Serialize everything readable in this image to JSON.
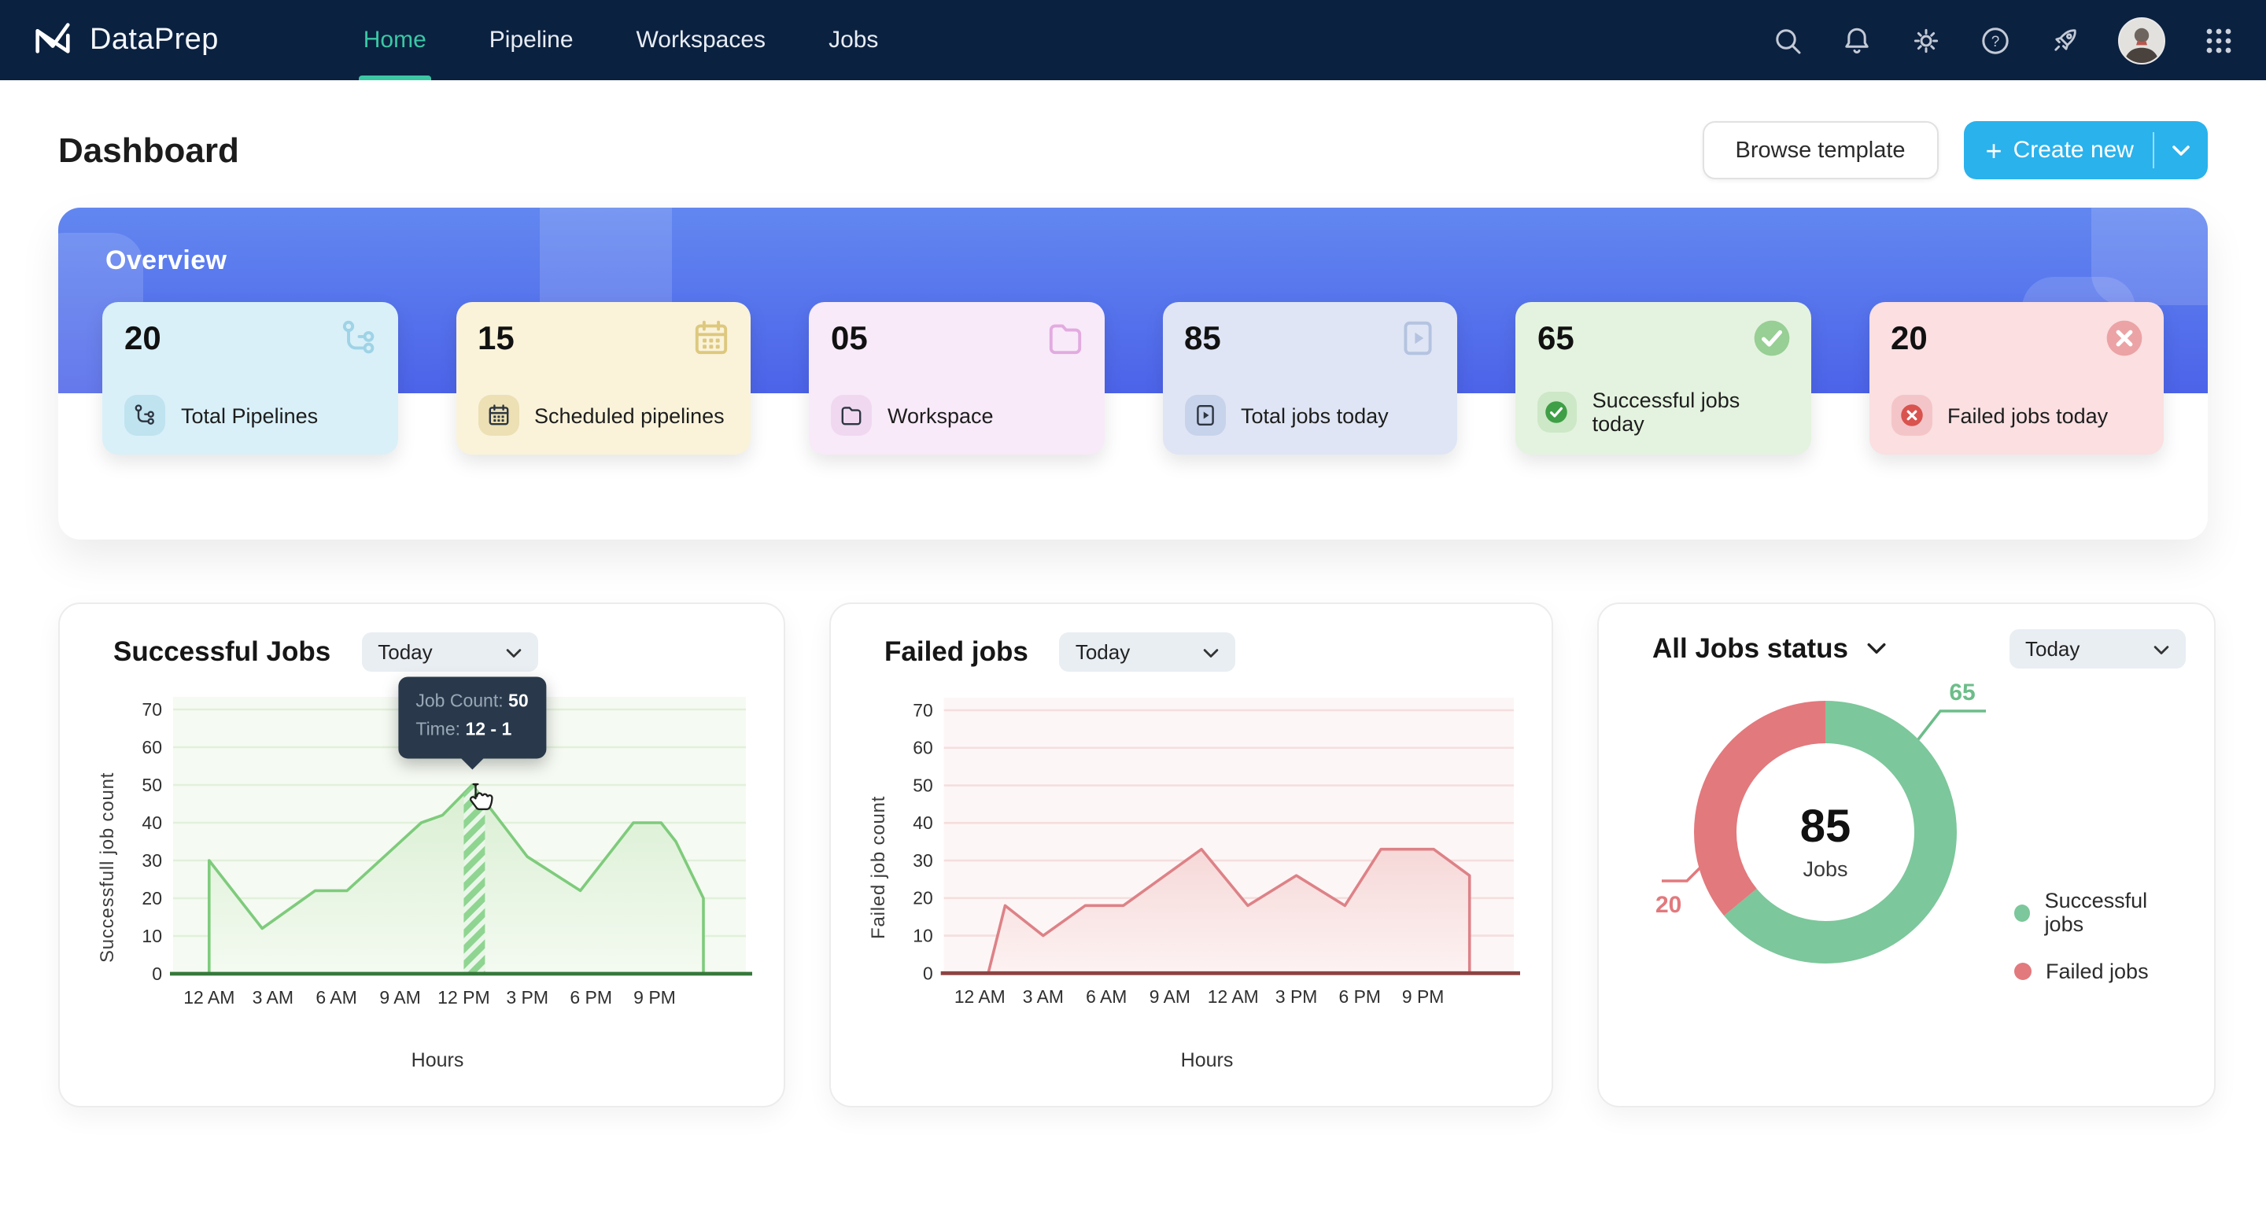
{
  "nav": {
    "brand": "DataPrep",
    "items": [
      {
        "label": "Home",
        "active": true
      },
      {
        "label": "Pipeline",
        "active": false
      },
      {
        "label": "Workspaces",
        "active": false
      },
      {
        "label": "Jobs",
        "active": false
      }
    ],
    "right_icons": [
      "search-icon",
      "bell-icon",
      "gear-icon",
      "help-icon",
      "rocket-icon",
      "avatar",
      "apps-grid-icon"
    ]
  },
  "header": {
    "title": "Dashboard",
    "browse_label": "Browse template",
    "create_label": "Create new"
  },
  "overview": {
    "title": "Overview",
    "cards": [
      {
        "value": "20",
        "label": "Total Pipelines",
        "icon": "pipeline-icon",
        "bg": "#d9f0f9",
        "chip": "#bfe3ef",
        "ghost": "#9fd3e6",
        "glyph": "#23454f"
      },
      {
        "value": "15",
        "label": "Scheduled pipelines",
        "icon": "calendar-icon",
        "bg": "#faf3da",
        "chip": "#ece0b4",
        "ghost": "#ddc87e",
        "glyph": "#4a4018"
      },
      {
        "value": "05",
        "label": "Workspace",
        "icon": "folder-icon",
        "bg": "#f8eaf9",
        "chip": "#f0d8f1",
        "ghost": "#e2abe0",
        "glyph": "#3f2a40"
      },
      {
        "value": "85",
        "label": "Total jobs today",
        "icon": "play-doc-icon",
        "bg": "#dfe5f4",
        "chip": "#c7d2eb",
        "ghost": "#b4c3e0",
        "glyph": "#273а55"
      },
      {
        "value": "65",
        "label": "Successful jobs today",
        "icon": "check-circle-icon",
        "bg": "#e4f3df",
        "chip": "#cde8c6",
        "ghost": "#97cf94",
        "glyph": "#3f9f46"
      },
      {
        "value": "20",
        "label": "Failed jobs today",
        "icon": "x-circle-icon",
        "bg": "#fbdfe1",
        "chip": "#f4c5c8",
        "ghost": "#eba3a6",
        "glyph": "#d9534f"
      }
    ]
  },
  "chart_data": [
    {
      "type": "area",
      "title": "Successful Jobs",
      "period": "Today",
      "xlabel": "Hours",
      "ylabel": "Successfull job count",
      "ylim": [
        0,
        70
      ],
      "yticks": [
        0,
        10,
        20,
        30,
        40,
        50,
        60,
        70
      ],
      "xticks": [
        "12 AM",
        "3 AM",
        "6 AM",
        "9 AM",
        "12 PM",
        "3 PM",
        "6 PM",
        "9 PM"
      ],
      "x": [
        0,
        2.5,
        5,
        6.5,
        10,
        11,
        12.4,
        13.5,
        15,
        17.5,
        20,
        21.3,
        22,
        23.3
      ],
      "values": [
        30,
        12,
        22,
        22,
        40,
        42,
        50,
        42,
        31,
        22,
        40,
        40,
        35,
        20
      ],
      "highlight": {
        "from_hour": 12,
        "to_hour": 13
      },
      "tooltip": {
        "label_1": "Job Count:",
        "value_1": "50",
        "label_2": "Time:",
        "value_2": "12 - 1"
      },
      "colors": {
        "line": "#7ecb7c",
        "fill_top": "#d9efd2",
        "fill_bottom": "#f4faf1",
        "grid": "#e2f0da",
        "axis": "#35783a",
        "plot_bg": "#f5faf2",
        "band": "#8fd591",
        "band_stripe": "#ffffff"
      }
    },
    {
      "type": "area",
      "title": "Failed jobs",
      "period": "Today",
      "xlabel": "Hours",
      "ylabel": "Failed job count",
      "ylim": [
        0,
        70
      ],
      "yticks": [
        0,
        10,
        20,
        30,
        40,
        50,
        60,
        70
      ],
      "xticks": [
        "12 AM",
        "3 AM",
        "6 AM",
        "9 AM",
        "12 AM",
        "3 PM",
        "6 PM",
        "9 PM"
      ],
      "x": [
        0.4,
        1.2,
        3,
        5,
        6.8,
        10.5,
        12.7,
        15,
        17.3,
        19,
        21.5,
        23.2
      ],
      "values": [
        0,
        18,
        10,
        18,
        18,
        33,
        18,
        26,
        18,
        33,
        33,
        26
      ],
      "colors": {
        "line": "#dd8287",
        "fill_top": "#f6d8d8",
        "fill_bottom": "#fdf2f2",
        "grid": "#f5dede",
        "axis": "#8d4343",
        "plot_bg": "#fdf6f6"
      }
    },
    {
      "type": "donut",
      "title": "All Jobs status",
      "period": "Today",
      "center_value": "85",
      "center_label": "Jobs",
      "segments": [
        {
          "label": "Successful jobs",
          "value": 65,
          "color": "#7cc79b",
          "callout": "65",
          "callout_color": "#6cbd89"
        },
        {
          "label": "Failed jobs",
          "value": 20,
          "color": "#e2797d",
          "callout": "20",
          "callout_color": "#e2797d"
        }
      ],
      "legend_position": "right",
      "visual_fractions": [
        0.64,
        0.36
      ]
    }
  ]
}
